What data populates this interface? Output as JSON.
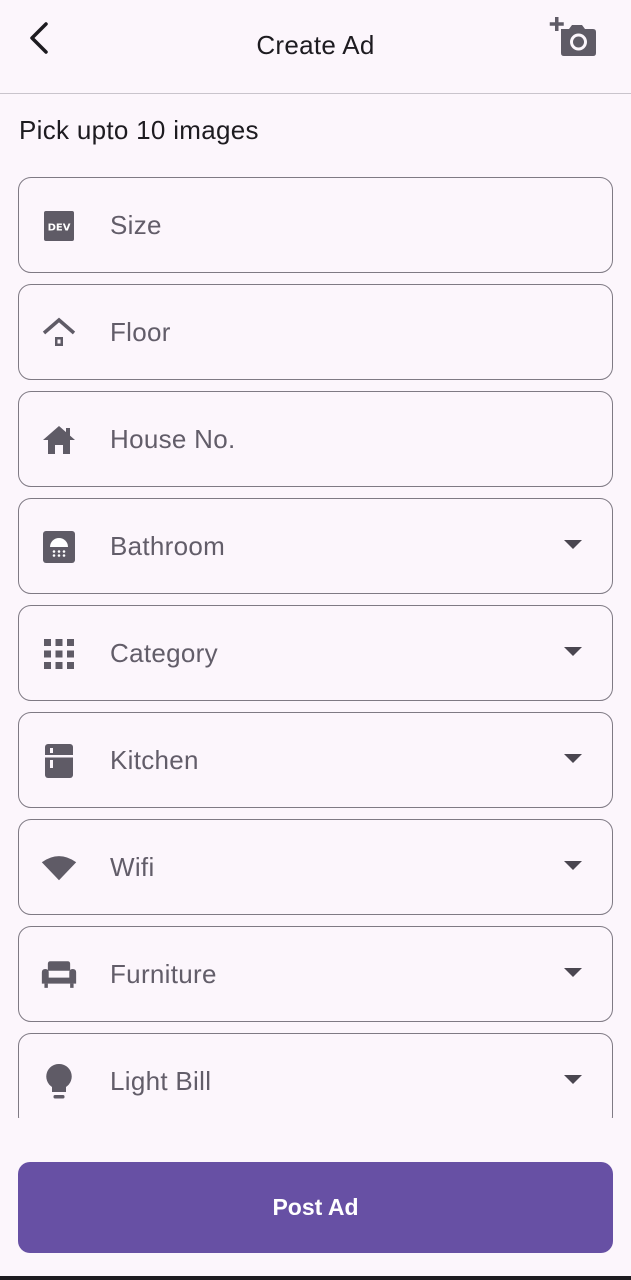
{
  "appbar": {
    "title": "Create Ad",
    "back_icon": "arrow-back-icon",
    "camera_icon": "add-a-photo-icon"
  },
  "pick_images_label": "Pick upto 10 images",
  "fields": [
    {
      "label": "Size",
      "icon": "developer-board-icon",
      "dropdown": false
    },
    {
      "label": "Floor",
      "icon": "house-outline-icon",
      "dropdown": false
    },
    {
      "label": "House No.",
      "icon": "house-icon",
      "dropdown": false
    },
    {
      "label": "Bathroom",
      "icon": "shower-icon",
      "dropdown": true
    },
    {
      "label": "Category",
      "icon": "apps-grid-icon",
      "dropdown": true
    },
    {
      "label": "Kitchen",
      "icon": "kitchen-icon",
      "dropdown": true
    },
    {
      "label": "Wifi",
      "icon": "wifi-icon",
      "dropdown": true
    },
    {
      "label": "Furniture",
      "icon": "chair-icon",
      "dropdown": true
    },
    {
      "label": "Light Bill",
      "icon": "lightbulb-icon",
      "dropdown": true
    }
  ],
  "post_button_label": "Post Ad",
  "colors": {
    "background": "#fcf6fc",
    "primary": "#6750a4",
    "outline": "#7f7a84",
    "label": "#625d69",
    "icon": "#5f5b66"
  }
}
